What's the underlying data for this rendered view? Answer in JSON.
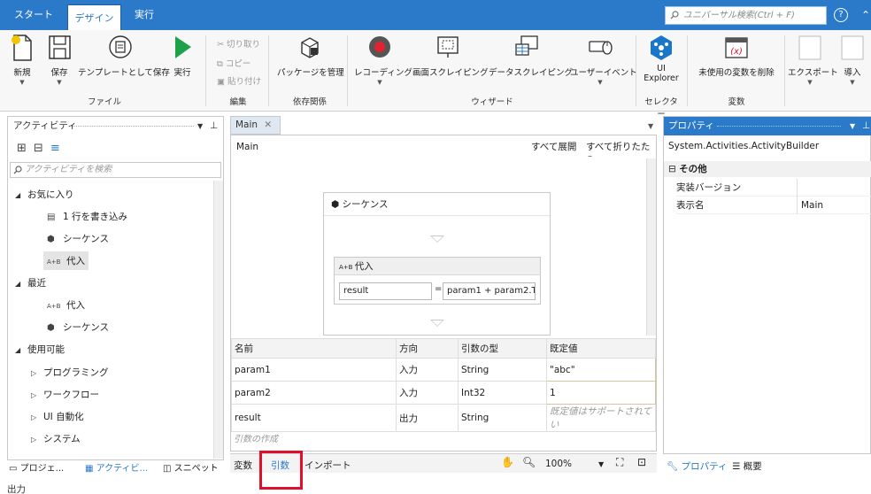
{
  "titlebar": {
    "tabs": [
      "スタート",
      "デザイン",
      "実行"
    ],
    "search_placeholder": "ユニバーサル検索(Ctrl + F)",
    "help": "?"
  },
  "ribbon": {
    "file": {
      "new": "新規",
      "save": "保存",
      "save_template": "テンプレートとして保存",
      "run": "実行",
      "group": "ファイル"
    },
    "edit": {
      "cut": "切り取り",
      "copy": "コピー",
      "paste": "貼り付け",
      "group": "編集"
    },
    "deps": {
      "manage": "パッケージを管理",
      "group": "依存関係"
    },
    "wizard": {
      "recording": "レコーディング",
      "screen_scraping": "画面スクレイピング",
      "data_scraping": "データスクレイピング",
      "user_event": "ユーザーイベント",
      "group": "ウィザード"
    },
    "selector": {
      "ui_explorer_1": "UI",
      "ui_explorer_2": "Explorer",
      "group": "セレクター"
    },
    "variables": {
      "remove_unused": "未使用の変数を削除",
      "group": "変数"
    },
    "export": "エクスポート",
    "import": "導入"
  },
  "activities": {
    "title": "アクティビティ",
    "search_placeholder": "アクティビティを検索",
    "sections": [
      {
        "label": "お気に入り",
        "items": [
          "1 行を書き込み",
          "シーケンス",
          "代入"
        ]
      },
      {
        "label": "最近",
        "items": [
          "代入",
          "シーケンス"
        ]
      },
      {
        "label": "使用可能",
        "items": [
          "プログラミング",
          "ワークフロー",
          "UI 自動化",
          "システム"
        ]
      }
    ],
    "bottom_tabs": [
      "プロジェ...",
      "アクティビ...",
      "スニペット"
    ]
  },
  "designer": {
    "tab": "Main",
    "breadcrumb": "Main",
    "expand_all": "すべて展開",
    "collapse_all": "すべて折りたたみ",
    "sequence": "シーケンス",
    "assign": "代入",
    "assign_to": "result",
    "assign_value": "param1 + param2.T",
    "args_headers": [
      "名前",
      "方向",
      "引数の型",
      "既定値"
    ],
    "args_rows": [
      [
        "param1",
        "入力",
        "String",
        "\"abc\""
      ],
      [
        "param2",
        "入力",
        "Int32",
        "1"
      ],
      [
        "result",
        "出力",
        "String",
        "既定値はサポートされてい"
      ]
    ],
    "create_arg": "引数の作成",
    "bottom_tabs": [
      "変数",
      "引数",
      "インポート"
    ],
    "zoom": "100%"
  },
  "properties": {
    "title": "プロパティ",
    "type": "System.Activities.ActivityBuilder",
    "category": "その他",
    "rows": [
      {
        "name": "実装バージョン",
        "value": ""
      },
      {
        "name": "表示名",
        "value": "Main"
      }
    ],
    "bottom_tabs": [
      "プロパティ",
      "概要"
    ]
  },
  "output_label": "出力"
}
